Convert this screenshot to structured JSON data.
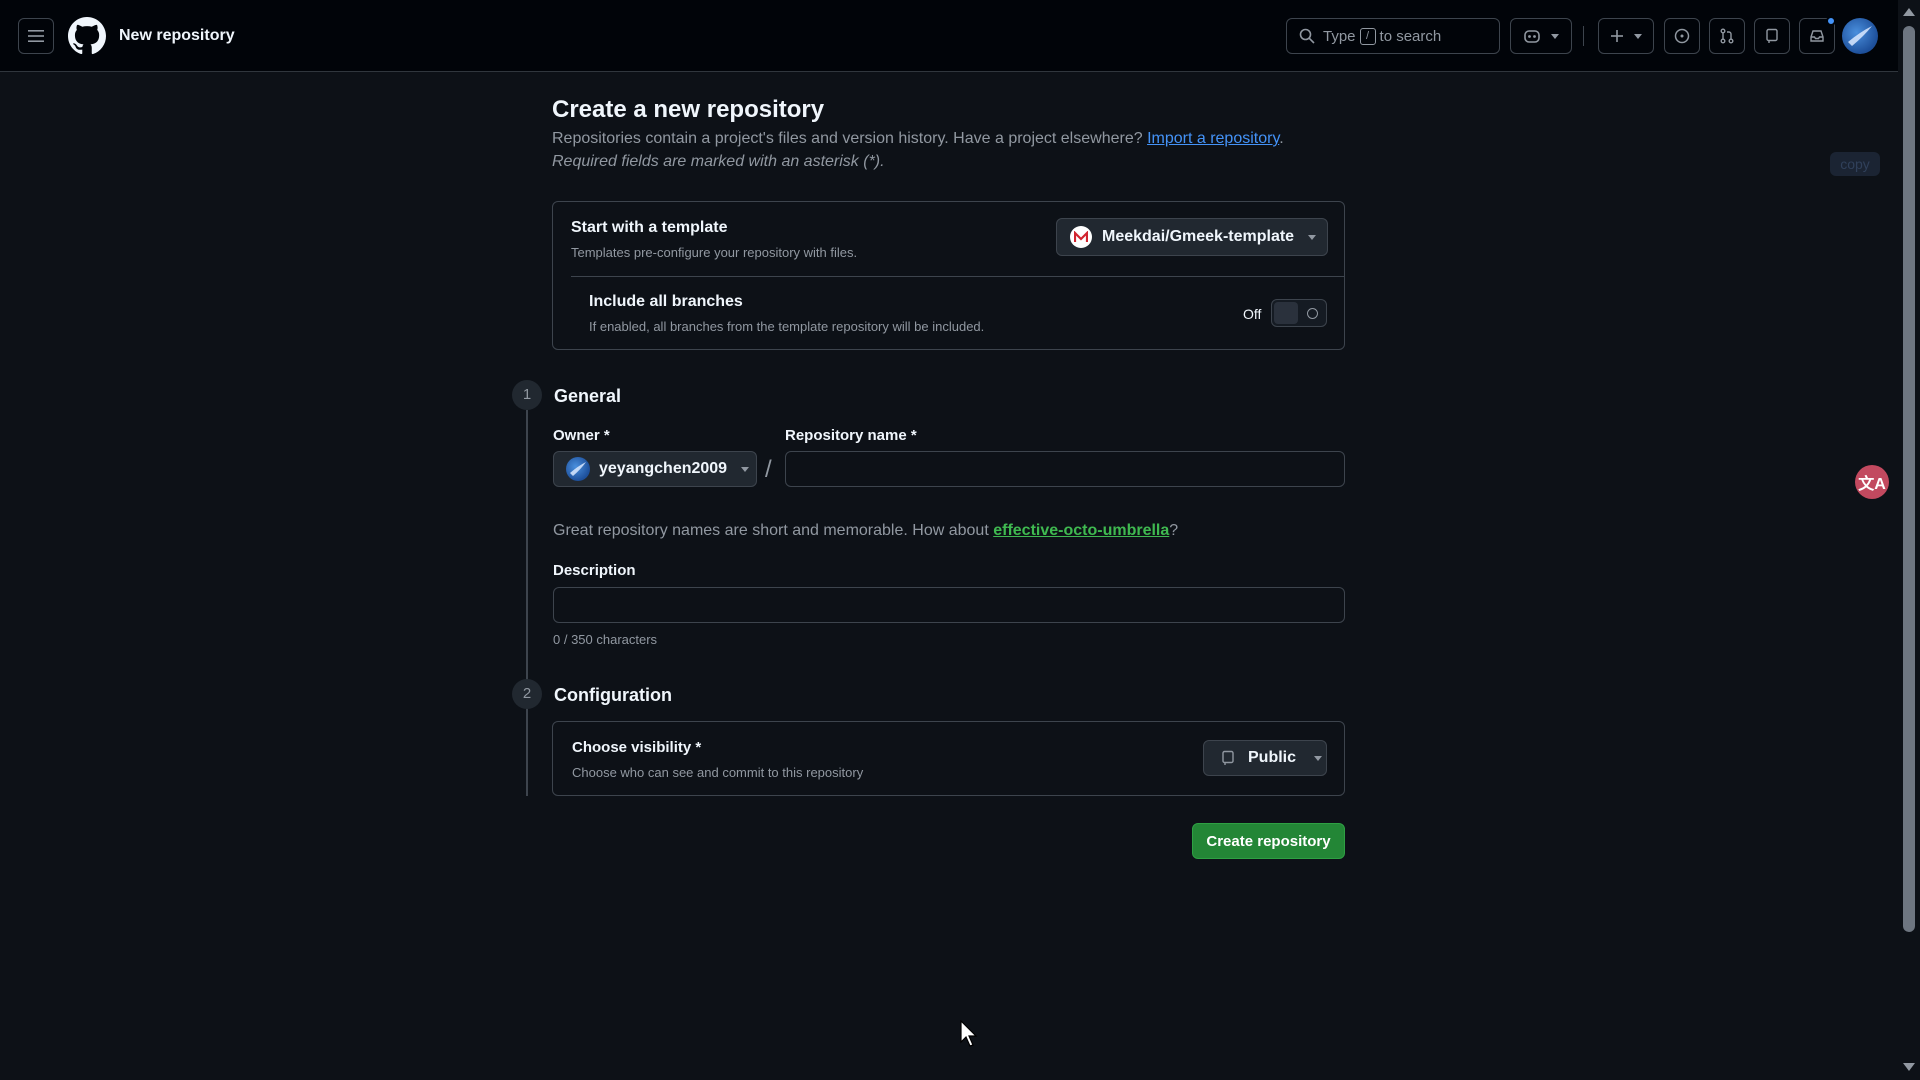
{
  "header": {
    "page_name": "New repository",
    "search": {
      "prefix": "Type",
      "key": "/",
      "suffix": "to search"
    }
  },
  "main": {
    "title": "Create a new repository",
    "subtitle": "Repositories contain a project's files and version history. Have a project elsewhere?",
    "import_link": "Import a repository",
    "subtitle_end": ".",
    "required_note": "Required fields are marked with an asterisk (*).",
    "copy_badge": "copy",
    "translate_glyph": "文A"
  },
  "template": {
    "label": "Start with a template",
    "desc": "Templates pre-configure your repository with files.",
    "selected": "Meekdai/Gmeek-template",
    "branches_label": "Include all branches",
    "branches_desc": "If enabled, all branches from the template repository will be included.",
    "toggle_state": "Off"
  },
  "general": {
    "step": "1",
    "title": "General",
    "owner_label": "Owner *",
    "owner_value": "yeyangchen2009",
    "slash": "/",
    "repo_label": "Repository name *",
    "repo_value": "",
    "hint_prefix": "Great repository names are short and memorable. How about",
    "hint_suggestion": "effective-octo-umbrella",
    "hint_suffix": "?",
    "desc_label": "Description",
    "desc_value": "",
    "char_count": "0 / 350 characters"
  },
  "configuration": {
    "step": "2",
    "title": "Configuration",
    "visibility_label": "Choose visibility *",
    "visibility_desc": "Choose who can see and commit to this repository",
    "visibility_value": "Public"
  },
  "actions": {
    "create_label": "Create repository"
  },
  "colors": {
    "primary_button": "#238636",
    "link": "#4493f8",
    "suggestion": "#3fb950",
    "background": "#0d1117"
  }
}
